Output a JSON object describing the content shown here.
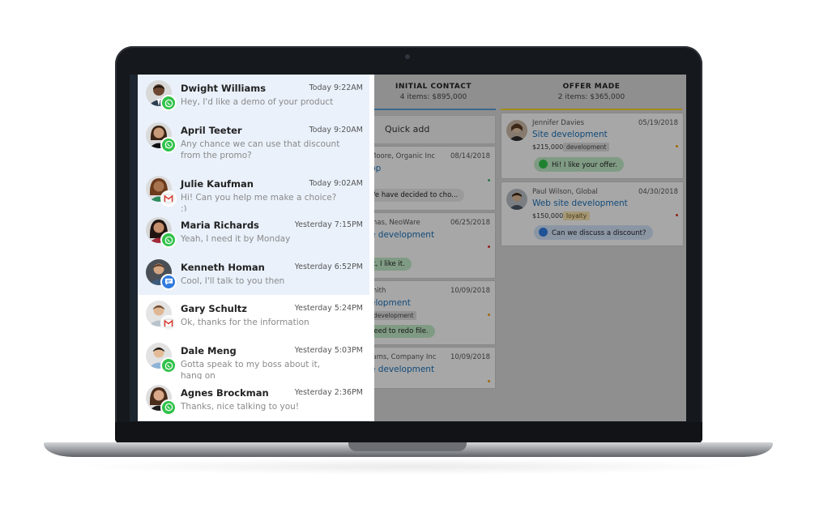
{
  "colors": {
    "accent_blue": "#1a6fb5",
    "unread_bg": "#eaf1fb",
    "whatsapp": "#30c24a",
    "chat": "#2f7be0",
    "gmail_red": "#d9342b",
    "initial_contact_rule": "#5b9bd5",
    "offer_made_rule": "#f2d02b"
  },
  "pipeline": {
    "columns": [
      {
        "title": "INITIAL CONTACT",
        "subtitle": "4 items: $895,000"
      },
      {
        "title": "OFFER MADE",
        "subtitle": "2 items: $365,000"
      }
    ],
    "quick_add_label": "Quick add",
    "initial_cards": [
      {
        "who": "Moore, Organic Inc",
        "date": "08/14/2018",
        "deal": "pp",
        "message": "We have decided to cho...",
        "status_color": "#3cb371"
      },
      {
        "who": "mas, NeoWare",
        "date": "06/25/2018",
        "deal": "e development",
        "message": "at, I like it.",
        "status_color": "#d9342b"
      },
      {
        "who": "mith",
        "date": "10/09/2018",
        "deal": "elopment",
        "tag": "development",
        "message": "Need to redo file.",
        "status_color": "#f39c12"
      },
      {
        "who": "iams, Company Inc",
        "date": "10/09/2018",
        "deal": "e development",
        "status_color": "#f39c12"
      }
    ],
    "offer_cards": [
      {
        "who": "Jennifer Davies",
        "date": "05/19/2018",
        "deal": "Site development",
        "amount": "$215,000",
        "tag": "development",
        "message": "Hi! I like your offer.",
        "channel_icon": "whatsapp-icon",
        "status_color": "#f39c12"
      },
      {
        "who": "Paul Wilson, Global",
        "date": "04/30/2018",
        "deal": "Web site development",
        "amount": "$150,000",
        "tag": "loyalty",
        "message": "Can we discuss a discount?",
        "channel_icon": "chat-icon",
        "status_color": "#d9342b"
      }
    ]
  },
  "conversations": [
    {
      "name": "Dwight Williams",
      "time": "Today 9:22AM",
      "message": "Hey, I'd like a demo of your product",
      "channel": "whatsapp-icon",
      "unread": true
    },
    {
      "name": "April Teeter",
      "time": "Today 9:20AM",
      "message": "Any chance we can use that discount from the promo?",
      "channel": "whatsapp-icon",
      "unread": true
    },
    {
      "name": "Julie Kaufman",
      "time": "Today 9:02AM",
      "message": "Hi! Can you help me make a choice? :)",
      "channel": "gmail-icon",
      "unread": true
    },
    {
      "name": "Maria Richards",
      "time": "Yesterday 7:15PM",
      "message": "Yeah, I need it by Monday",
      "channel": "whatsapp-icon",
      "unread": true
    },
    {
      "name": "Kenneth Homan",
      "time": "Yesterday 6:52PM",
      "message": "Cool, I'll talk to you then",
      "channel": "chat-icon",
      "unread": true
    },
    {
      "name": "Gary Schultz",
      "time": "Yesterday 5:24PM",
      "message": "Ok, thanks for the information",
      "channel": "gmail-icon",
      "unread": false
    },
    {
      "name": "Dale Meng",
      "time": "Yesterday 5:03PM",
      "message": "Gotta speak to my boss about it, hang on",
      "channel": "whatsapp-icon",
      "unread": false
    },
    {
      "name": "Agnes Brockman",
      "time": "Yesterday 2:36PM",
      "message": "Thanks, nice talking to you!",
      "channel": "whatsapp-icon",
      "unread": false
    }
  ]
}
